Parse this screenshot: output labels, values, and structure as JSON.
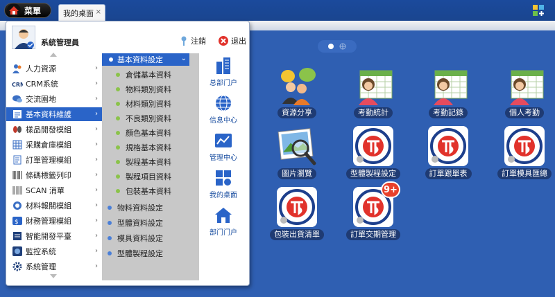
{
  "topbar": {
    "start_label": "菜單",
    "tab_label": "我的桌面",
    "tab_close": "×"
  },
  "menu": {
    "user_name": "系統管理員",
    "logout_label": "注銷",
    "exit_label": "退出",
    "left_items": [
      {
        "label": "人力資源",
        "icon": "people-icon"
      },
      {
        "label": "CRM系統",
        "icon": "crm-icon"
      },
      {
        "label": "交流園地",
        "icon": "chat-icon"
      },
      {
        "label": "基本資料維護",
        "icon": "document-icon",
        "active": true
      },
      {
        "label": "樣品開發模組",
        "icon": "footprint-icon"
      },
      {
        "label": "采購倉庫模組",
        "icon": "grid-icon"
      },
      {
        "label": "訂單管理模組",
        "icon": "order-icon"
      },
      {
        "label": "條碼標籤列印",
        "icon": "barcode-icon"
      },
      {
        "label": "SCAN 消單",
        "icon": "scan-icon"
      },
      {
        "label": "材料報關模組",
        "icon": "customs-icon"
      },
      {
        "label": "財務管理模組",
        "icon": "finance-icon"
      },
      {
        "label": "智能開發平臺",
        "icon": "platform-icon"
      },
      {
        "label": "監控系統",
        "icon": "monitor-icon"
      },
      {
        "label": "系統管理",
        "icon": "gear-icon"
      }
    ],
    "mid_head": "基本資料設定",
    "mid_sub_items": [
      "倉儲基本資料",
      "物料類別資料",
      "材料類別資料",
      "不良類別資料",
      "顏色基本資料",
      "規格基本資料",
      "製程基本資料",
      "製程項目資料",
      "包裝基本資料"
    ],
    "mid_top_items": [
      "物料資料設定",
      "型體資料設定",
      "模具資料設定",
      "型體製程設定"
    ],
    "right_items": [
      {
        "label": "总部门户",
        "icon": "building-icon"
      },
      {
        "label": "信息中心",
        "icon": "globe-icon"
      },
      {
        "label": "管理中心",
        "icon": "chart-icon"
      },
      {
        "label": "我的桌面",
        "icon": "desktop-icon"
      },
      {
        "label": "部门门户",
        "icon": "house-icon"
      }
    ]
  },
  "desktop": {
    "icons": [
      {
        "label": "資源分享",
        "icon": "share-people-icon"
      },
      {
        "label": "考勤統計",
        "icon": "attendance-icon"
      },
      {
        "label": "考勤記錄",
        "icon": "attendance-icon"
      },
      {
        "label": "個人考勤",
        "icon": "attendance-icon"
      },
      {
        "label": "圖片瀏覽",
        "icon": "image-browse-icon"
      },
      {
        "label": "型體製程設定",
        "icon": "company-logo-icon"
      },
      {
        "label": "訂單跟單表",
        "icon": "company-logo-icon"
      },
      {
        "label": "訂單模具匯總",
        "icon": "company-logo-icon"
      },
      {
        "label": "包裝出貨清單",
        "icon": "company-logo-icon"
      },
      {
        "label": "訂單交期管理",
        "icon": "company-logo-icon",
        "badge": "9+"
      }
    ]
  },
  "colors": {
    "accent": "#2a64c8",
    "desktop_bg": "#2f5fb2",
    "badge": "#e8402b"
  }
}
